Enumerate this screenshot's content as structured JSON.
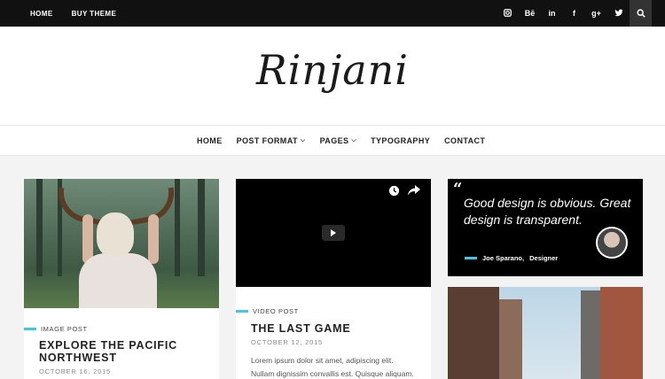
{
  "topbar": {
    "links": [
      "HOME",
      "BUY THEME"
    ],
    "socials": [
      {
        "name": "instagram-icon",
        "glyph": "◘"
      },
      {
        "name": "behance-icon",
        "glyph": "Bē"
      },
      {
        "name": "linkedin-icon",
        "glyph": "in"
      },
      {
        "name": "facebook-icon",
        "glyph": "f"
      },
      {
        "name": "google-plus-icon",
        "glyph": "g+"
      },
      {
        "name": "twitter-icon",
        "glyph": "🐦"
      }
    ]
  },
  "logo": "Rinjani",
  "nav": {
    "items": [
      {
        "label": "HOME",
        "dropdown": false
      },
      {
        "label": "POST FORMAT",
        "dropdown": true
      },
      {
        "label": "PAGES",
        "dropdown": true
      },
      {
        "label": "TYPOGRAPHY",
        "dropdown": false
      },
      {
        "label": "CONTACT",
        "dropdown": false
      }
    ]
  },
  "posts": [
    {
      "category": "IMAGE POST",
      "title": "EXPLORE THE PACIFIC NORTHWEST",
      "date": "OCTOBER 16, 2015"
    },
    {
      "category": "VIDEO POST",
      "title": "THE LAST GAME",
      "date": "OCTOBER 12, 2015",
      "excerpt_line1": "Lorem ipsum dolor sit amet,  adipiscing elit.",
      "excerpt_line2": "Nullam dignissim convallis est. Quisque aliquam."
    }
  ],
  "quote": {
    "text": "Good design is obvious. Great design is transparent.",
    "author": "Joe Sparano,",
    "role": "Designer"
  },
  "colors": {
    "accent": "#3ec7e6",
    "topbar": "#111111"
  }
}
